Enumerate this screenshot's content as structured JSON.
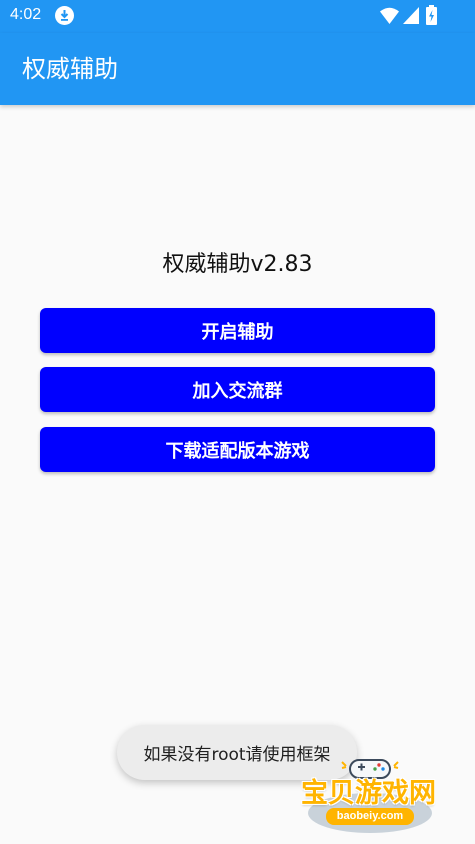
{
  "status_bar": {
    "time": "4:02",
    "icons": [
      "download-icon",
      "wifi-icon",
      "signal-icon",
      "battery-icon"
    ]
  },
  "app_bar": {
    "title": "权威辅助"
  },
  "main": {
    "title": "权威辅助v2.83",
    "buttons": [
      {
        "label": "开启辅助"
      },
      {
        "label": "加入交流群"
      },
      {
        "label": "下载适配版本游戏"
      }
    ]
  },
  "toast": {
    "message": "如果没有root请使用框架"
  },
  "watermark": {
    "name": "宝贝游戏网",
    "domain": "baobeiy.com"
  },
  "colors": {
    "primary": "#2196f3",
    "button": "#0000ff",
    "background": "#fafafa",
    "toast_bg": "#ececec",
    "watermark_accent": "#ffb400"
  }
}
